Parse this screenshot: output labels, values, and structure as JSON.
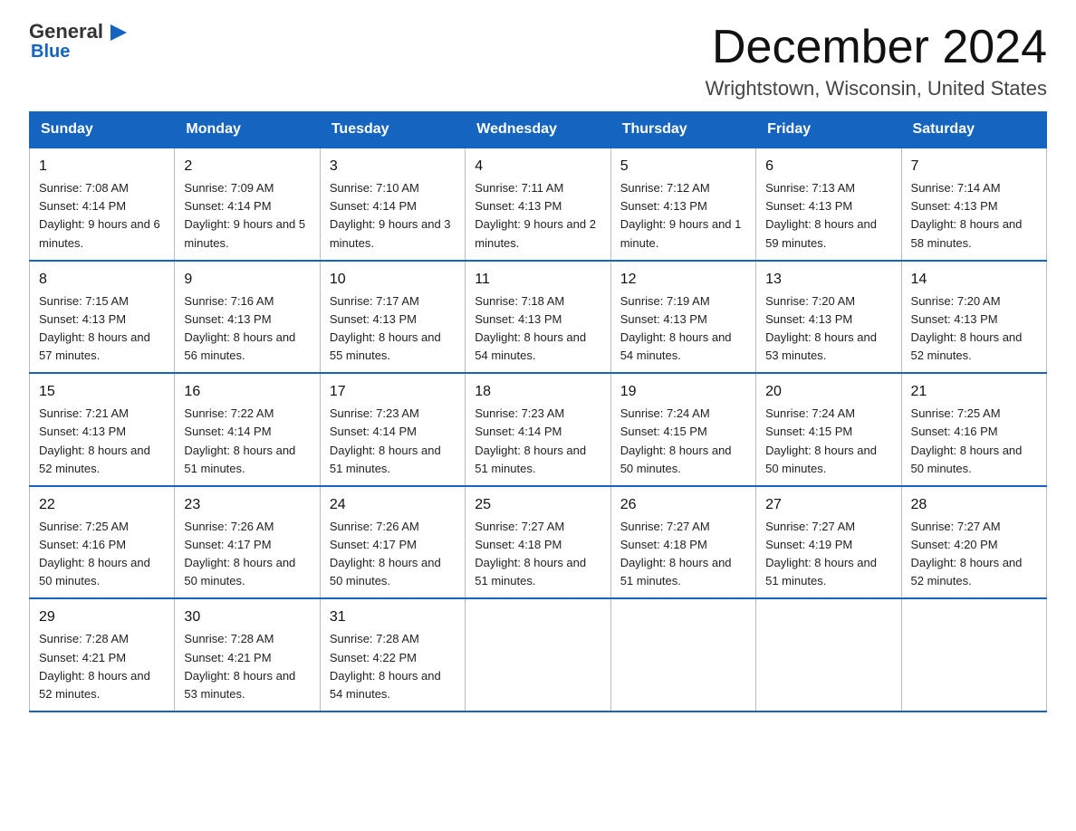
{
  "header": {
    "logo_top": "General",
    "logo_triangle": "▶",
    "logo_bottom": "Blue",
    "month_title": "December 2024",
    "location": "Wrightstown, Wisconsin, United States"
  },
  "days_of_week": [
    "Sunday",
    "Monday",
    "Tuesday",
    "Wednesday",
    "Thursday",
    "Friday",
    "Saturday"
  ],
  "weeks": [
    [
      {
        "day": "1",
        "sunrise": "7:08 AM",
        "sunset": "4:14 PM",
        "daylight": "9 hours and 6 minutes."
      },
      {
        "day": "2",
        "sunrise": "7:09 AM",
        "sunset": "4:14 PM",
        "daylight": "9 hours and 5 minutes."
      },
      {
        "day": "3",
        "sunrise": "7:10 AM",
        "sunset": "4:14 PM",
        "daylight": "9 hours and 3 minutes."
      },
      {
        "day": "4",
        "sunrise": "7:11 AM",
        "sunset": "4:13 PM",
        "daylight": "9 hours and 2 minutes."
      },
      {
        "day": "5",
        "sunrise": "7:12 AM",
        "sunset": "4:13 PM",
        "daylight": "9 hours and 1 minute."
      },
      {
        "day": "6",
        "sunrise": "7:13 AM",
        "sunset": "4:13 PM",
        "daylight": "8 hours and 59 minutes."
      },
      {
        "day": "7",
        "sunrise": "7:14 AM",
        "sunset": "4:13 PM",
        "daylight": "8 hours and 58 minutes."
      }
    ],
    [
      {
        "day": "8",
        "sunrise": "7:15 AM",
        "sunset": "4:13 PM",
        "daylight": "8 hours and 57 minutes."
      },
      {
        "day": "9",
        "sunrise": "7:16 AM",
        "sunset": "4:13 PM",
        "daylight": "8 hours and 56 minutes."
      },
      {
        "day": "10",
        "sunrise": "7:17 AM",
        "sunset": "4:13 PM",
        "daylight": "8 hours and 55 minutes."
      },
      {
        "day": "11",
        "sunrise": "7:18 AM",
        "sunset": "4:13 PM",
        "daylight": "8 hours and 54 minutes."
      },
      {
        "day": "12",
        "sunrise": "7:19 AM",
        "sunset": "4:13 PM",
        "daylight": "8 hours and 54 minutes."
      },
      {
        "day": "13",
        "sunrise": "7:20 AM",
        "sunset": "4:13 PM",
        "daylight": "8 hours and 53 minutes."
      },
      {
        "day": "14",
        "sunrise": "7:20 AM",
        "sunset": "4:13 PM",
        "daylight": "8 hours and 52 minutes."
      }
    ],
    [
      {
        "day": "15",
        "sunrise": "7:21 AM",
        "sunset": "4:13 PM",
        "daylight": "8 hours and 52 minutes."
      },
      {
        "day": "16",
        "sunrise": "7:22 AM",
        "sunset": "4:14 PM",
        "daylight": "8 hours and 51 minutes."
      },
      {
        "day": "17",
        "sunrise": "7:23 AM",
        "sunset": "4:14 PM",
        "daylight": "8 hours and 51 minutes."
      },
      {
        "day": "18",
        "sunrise": "7:23 AM",
        "sunset": "4:14 PM",
        "daylight": "8 hours and 51 minutes."
      },
      {
        "day": "19",
        "sunrise": "7:24 AM",
        "sunset": "4:15 PM",
        "daylight": "8 hours and 50 minutes."
      },
      {
        "day": "20",
        "sunrise": "7:24 AM",
        "sunset": "4:15 PM",
        "daylight": "8 hours and 50 minutes."
      },
      {
        "day": "21",
        "sunrise": "7:25 AM",
        "sunset": "4:16 PM",
        "daylight": "8 hours and 50 minutes."
      }
    ],
    [
      {
        "day": "22",
        "sunrise": "7:25 AM",
        "sunset": "4:16 PM",
        "daylight": "8 hours and 50 minutes."
      },
      {
        "day": "23",
        "sunrise": "7:26 AM",
        "sunset": "4:17 PM",
        "daylight": "8 hours and 50 minutes."
      },
      {
        "day": "24",
        "sunrise": "7:26 AM",
        "sunset": "4:17 PM",
        "daylight": "8 hours and 50 minutes."
      },
      {
        "day": "25",
        "sunrise": "7:27 AM",
        "sunset": "4:18 PM",
        "daylight": "8 hours and 51 minutes."
      },
      {
        "day": "26",
        "sunrise": "7:27 AM",
        "sunset": "4:18 PM",
        "daylight": "8 hours and 51 minutes."
      },
      {
        "day": "27",
        "sunrise": "7:27 AM",
        "sunset": "4:19 PM",
        "daylight": "8 hours and 51 minutes."
      },
      {
        "day": "28",
        "sunrise": "7:27 AM",
        "sunset": "4:20 PM",
        "daylight": "8 hours and 52 minutes."
      }
    ],
    [
      {
        "day": "29",
        "sunrise": "7:28 AM",
        "sunset": "4:21 PM",
        "daylight": "8 hours and 52 minutes."
      },
      {
        "day": "30",
        "sunrise": "7:28 AM",
        "sunset": "4:21 PM",
        "daylight": "8 hours and 53 minutes."
      },
      {
        "day": "31",
        "sunrise": "7:28 AM",
        "sunset": "4:22 PM",
        "daylight": "8 hours and 54 minutes."
      },
      null,
      null,
      null,
      null
    ]
  ]
}
